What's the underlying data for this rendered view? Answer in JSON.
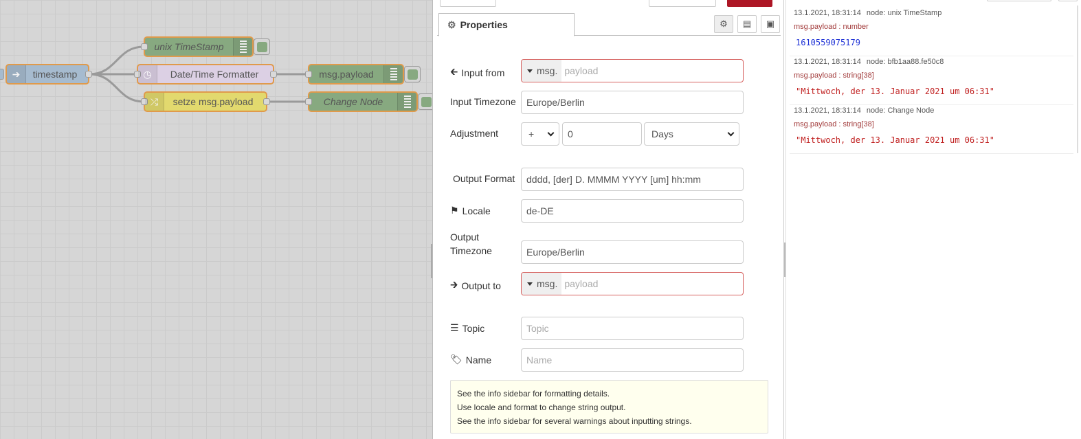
{
  "workspace": {
    "nodes": {
      "timestamp": "timestamp",
      "unix_timestamp": "unix TimeStamp",
      "datetime_formatter": "Date/Time Formatter",
      "msg_payload": "msg.payload",
      "setze": "setze msg.payload",
      "change_node": "Change Node"
    }
  },
  "editor": {
    "tab_label": "Properties",
    "fields": {
      "input_from": {
        "label": "Input from",
        "type_prefix": "msg.",
        "value": "payload"
      },
      "input_timezone": {
        "label": "Input Timezone",
        "value": "Europe/Berlin"
      },
      "adjustment": {
        "label": "Adjustment",
        "operator": "+",
        "amount": "0",
        "unit": "Days"
      },
      "output_format": {
        "label": "Output Format",
        "value": "dddd, [der] D. MMMM YYYY [um] hh:mm"
      },
      "locale": {
        "label": "Locale",
        "value": "de-DE"
      },
      "output_timezone": {
        "label_line1": "Output",
        "label_line2": "Timezone",
        "value": "Europe/Berlin"
      },
      "output_to": {
        "label": "Output to",
        "type_prefix": "msg.",
        "value": "payload"
      },
      "topic": {
        "label": "Topic",
        "placeholder": "Topic"
      },
      "name": {
        "label": "Name",
        "placeholder": "Name"
      }
    },
    "tips": [
      "See the info sidebar for formatting details.",
      "Use locale and format to change string output.",
      "See the info sidebar for several warnings about inputting strings."
    ]
  },
  "debug": {
    "messages": [
      {
        "time": "13.1.2021, 18:31:14",
        "node": "node: unix TimeStamp",
        "prop": "msg.payload : number",
        "value": "1610559075179"
      },
      {
        "time": "13.1.2021, 18:31:14",
        "node": "node: bfb1aa88.fe50c8",
        "prop": "msg.payload : string[38]",
        "value": "\"Mittwoch, der 13. Januar 2021 um 06:31\""
      },
      {
        "time": "13.1.2021, 18:31:14",
        "node": "node: Change Node",
        "prop": "msg.payload : string[38]",
        "value": "\"Mittwoch, der 13. Januar 2021 um 06:31\""
      }
    ]
  },
  "colors": {
    "node_border": "#e09a4b",
    "inject_node": "#a6bbcf",
    "debug_node": "#87a980",
    "datetime_node": "#deb6f0",
    "change_node": "#e2d96e",
    "error_border": "#d6615f",
    "deploy_red": "#ad1625",
    "debug_number": "#2033d6",
    "debug_string": "#c02020"
  }
}
